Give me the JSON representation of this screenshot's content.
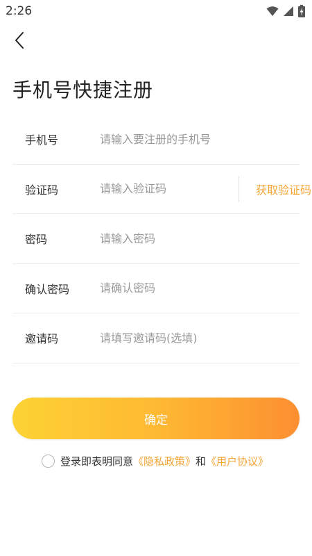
{
  "status_bar": {
    "time": "2:26",
    "icons": [
      "wifi-icon",
      "cell-signal-icon",
      "battery-charging-icon"
    ]
  },
  "header": {
    "back_icon": "chevron-left-icon",
    "title": "手机号快捷注册"
  },
  "form": {
    "phone": {
      "label": "手机号",
      "placeholder": "请输入要注册的手机号",
      "value": ""
    },
    "code": {
      "label": "验证码",
      "placeholder": "请输入验证码",
      "value": "",
      "action": "获取验证码"
    },
    "password": {
      "label": "密码",
      "placeholder": "请输入密码",
      "value": ""
    },
    "confirm_password": {
      "label": "确认密码",
      "placeholder": "请确认密码",
      "value": ""
    },
    "invite_code": {
      "label": "邀请码",
      "placeholder": "请填写邀请码(选填)",
      "value": ""
    }
  },
  "submit_label": "确定",
  "agreement": {
    "prefix": "登录即表明同意",
    "privacy_link": "《隐私政策》",
    "conjunction": "和",
    "terms_link": "《用户协议》",
    "checked": false
  },
  "colors": {
    "accent": "#f5a434",
    "button_gradient_start": "#fdd234",
    "button_gradient_end": "#fc8f31",
    "divider": "#ececec",
    "placeholder": "#999999"
  }
}
